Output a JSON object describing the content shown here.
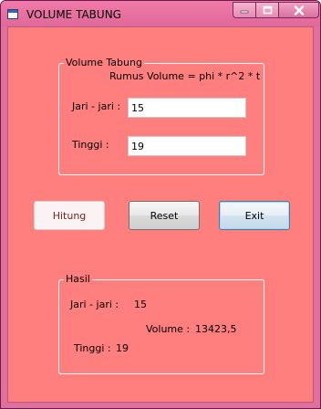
{
  "window": {
    "title": "VOLUME TABUNG",
    "icon": "app-window-icon"
  },
  "caption_buttons": {
    "minimize_icon": "minimize-icon",
    "maximize_icon": "maximize-icon",
    "close_icon": "close-icon"
  },
  "input_group": {
    "title": "Volume Tabung",
    "formula": "Rumus Volume = phi * r^2 * t",
    "jari_label": "Jari - jari :",
    "jari_value": "15",
    "tinggi_label": "Tinggi :",
    "tinggi_value": "19"
  },
  "buttons": {
    "hitung": "Hitung",
    "reset": "Reset",
    "exit": "Exit"
  },
  "result_group": {
    "title": "Hasil",
    "jari_label": "Jari - jari :",
    "jari_value": "15",
    "volume_label": "Volume :",
    "volume_value": "13423,5",
    "tinggi_label": "Tinggi :",
    "tinggi_value": "19"
  },
  "colors": {
    "client_background": "#ff7f7f",
    "frame": "#e0709b",
    "hitung_text": "#7a1f1f"
  }
}
